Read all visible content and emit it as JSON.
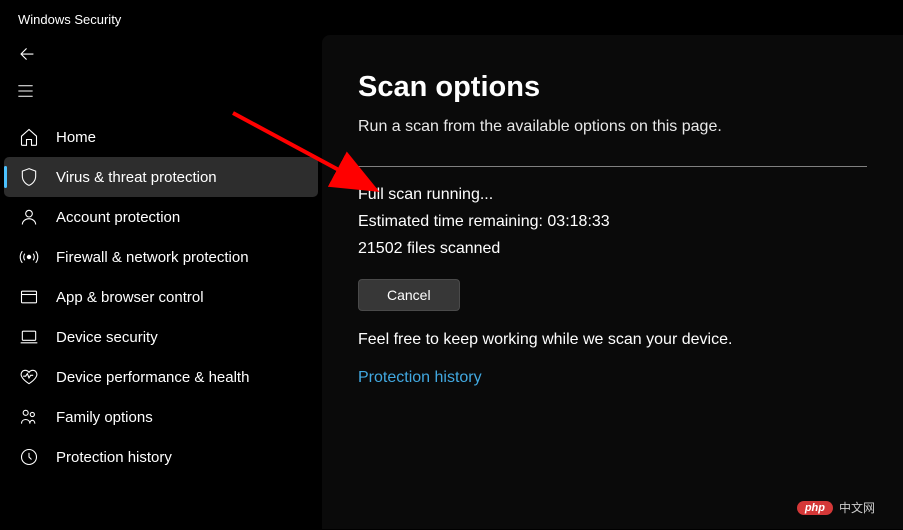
{
  "app": {
    "title": "Windows Security"
  },
  "sidebar": {
    "items": [
      {
        "label": "Home"
      },
      {
        "label": "Virus & threat protection"
      },
      {
        "label": "Account protection"
      },
      {
        "label": "Firewall & network protection"
      },
      {
        "label": "App & browser control"
      },
      {
        "label": "Device security"
      },
      {
        "label": "Device performance & health"
      },
      {
        "label": "Family options"
      },
      {
        "label": "Protection history"
      }
    ]
  },
  "main": {
    "title": "Scan options",
    "subtitle": "Run a scan from the available options on this page.",
    "status": {
      "running": "Full scan running...",
      "eta": "Estimated time remaining: 03:18:33",
      "files": "21502 files scanned"
    },
    "cancel_label": "Cancel",
    "info": "Feel free to keep working while we scan your device.",
    "protection_history_link": "Protection history"
  },
  "watermark": {
    "badge": "php",
    "text": "中文网"
  }
}
